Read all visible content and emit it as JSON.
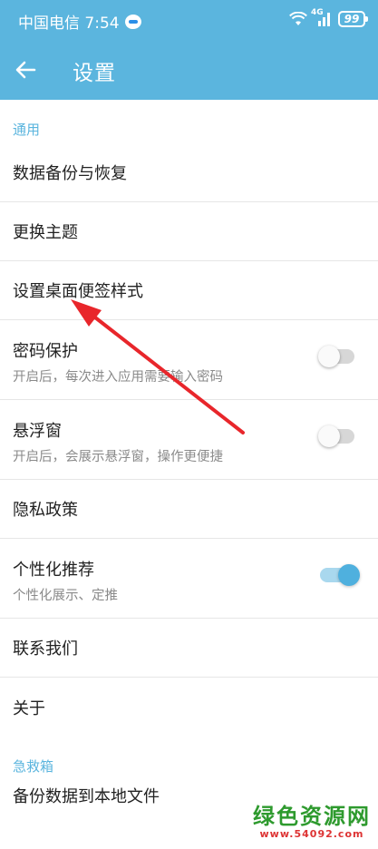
{
  "status_bar": {
    "carrier_time": "中国电信 7:54",
    "network": "4G",
    "battery": "99"
  },
  "app_bar": {
    "title": "设置"
  },
  "sections": {
    "general": {
      "header": "通用",
      "items": [
        {
          "title": "数据备份与恢复"
        },
        {
          "title": "更换主题"
        },
        {
          "title": "设置桌面便签样式"
        },
        {
          "title": "密码保护",
          "subtitle": "开启后，每次进入应用需要输入密码",
          "toggle": "off"
        },
        {
          "title": "悬浮窗",
          "subtitle": "开启后，会展示悬浮窗，操作更便捷",
          "toggle": "off"
        },
        {
          "title": "隐私政策"
        },
        {
          "title": "个性化推荐",
          "subtitle": "个性化展示、定推",
          "toggle": "on"
        },
        {
          "title": "联系我们"
        },
        {
          "title": "关于"
        }
      ]
    },
    "emergency": {
      "header": "急救箱",
      "items": [
        {
          "title": "备份数据到本地文件"
        }
      ]
    }
  },
  "watermark": {
    "text": "绿色资源网",
    "url": "www.54092.com"
  },
  "colors": {
    "accent": "#5bb5de",
    "annotation_arrow": "#e8262b",
    "watermark_green": "#2e9a2e"
  }
}
